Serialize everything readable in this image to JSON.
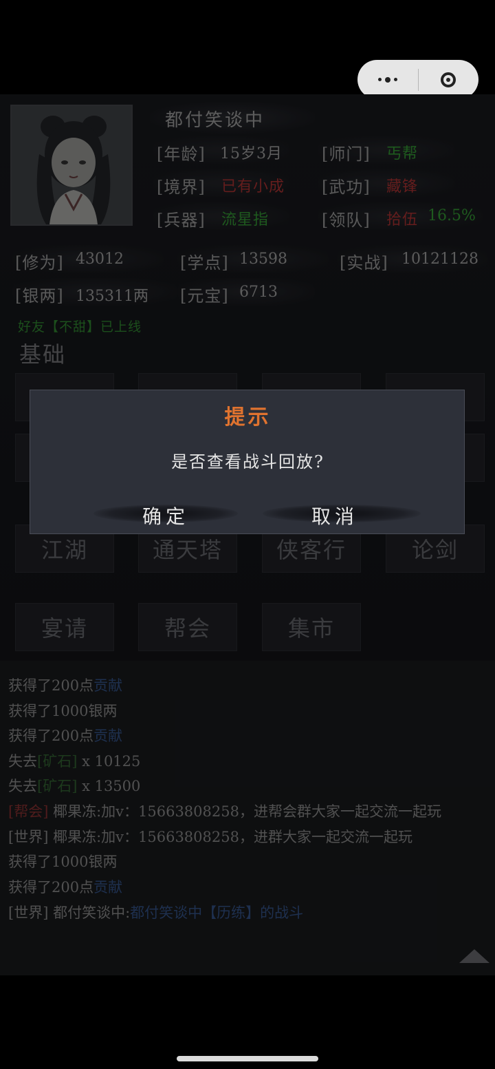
{
  "capsule": {
    "more_icon": "more-dots-icon",
    "close_icon": "target-circle-icon"
  },
  "profile": {
    "name": "都付笑谈中",
    "rows": [
      [
        {
          "label": "[年龄]",
          "value": "15岁3月",
          "color": "normal"
        },
        {
          "label": "[师门]",
          "value": "丐帮",
          "color": "green"
        }
      ],
      [
        {
          "label": "[境界]",
          "value": "已有小成",
          "color": "red"
        },
        {
          "label": "[武功]",
          "value": "藏锋",
          "color": "red"
        }
      ],
      [
        {
          "label": "[兵器]",
          "value": "流星指",
          "color": "green"
        },
        {
          "label": "[领队]",
          "value": "拾伍",
          "color": "red",
          "extra": "16.5%"
        }
      ]
    ]
  },
  "stats": {
    "xiuwei_label": "[修为]",
    "xiuwei": "43012",
    "xuedian_label": "[学点]",
    "xuedian": "13598",
    "shizhan_label": "[实战]",
    "shizhan": "10121128",
    "yinliang_label": "[银两]",
    "yinliang": "135311两",
    "yuanbao_label": "[元宝]",
    "yuanbao": "6713"
  },
  "friend_notice": "好友【不甜】已上线",
  "section_title": "基础",
  "menu_row3": [
    "江湖",
    "通天塔",
    "侠客行",
    "论剑"
  ],
  "menu_row4": [
    "宴请",
    "帮会",
    "集市"
  ],
  "log": [
    {
      "a": "获得了200点",
      "b": "贡献",
      "b_class": "blue"
    },
    {
      "a": "获得了1000银两"
    },
    {
      "a": "获得了200点",
      "b": "贡献",
      "b_class": "blue"
    },
    {
      "a": "失去",
      "b": "[矿石]",
      "b_class": "dim-green",
      "c": " x 10125"
    },
    {
      "a": "失去",
      "b": "[矿石]",
      "b_class": "dim-green",
      "c": " x 13500"
    },
    {
      "pre": "[帮会]",
      "pre_class": "red-dim",
      "a": " 椰果冻:加v：15663808258，进帮会群大家一起交流一起玩"
    },
    {
      "pre": "[世界]",
      "a": " 椰果冻:加v：15663808258，进群大家一起交流一起玩"
    },
    {
      "a": "获得了1000银两"
    },
    {
      "a": "获得了200点",
      "b": "贡献",
      "b_class": "blue"
    },
    {
      "pre": "[世界]",
      "a": " 都付笑谈中:",
      "b": "都付笑谈中【历练】的战斗",
      "b_class": "blue"
    }
  ],
  "dialog": {
    "title": "提示",
    "message": "是否查看战斗回放?",
    "confirm": "确定",
    "cancel": "取消"
  }
}
